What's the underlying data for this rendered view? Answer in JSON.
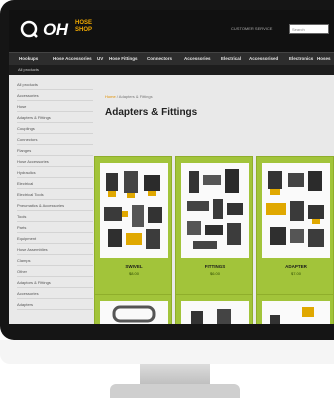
{
  "header": {
    "logo_text": "OH",
    "logo_sub_1": "HOSE",
    "logo_sub_2": "SHOP",
    "links": "CUSTOMER SERVICE",
    "search_placeholder": "Search"
  },
  "nav": {
    "items": [
      "Hookups",
      "Hose Accessories",
      "UV",
      "Hose Fittings",
      "Connectors",
      "Accessories",
      "Electrical",
      "Accessorised",
      "Electronics",
      "Hoses"
    ]
  },
  "subnav": {
    "label": "All products"
  },
  "sidebar": {
    "items": [
      "All products",
      "Accessories",
      "Hose",
      "Adapters & Fittings",
      "Couplings",
      "Connectors",
      "Flanges",
      "Hose Accessories",
      "Hydraulics",
      "Electrical",
      "Electrical Tools",
      "Pneumatics & Accessories",
      "Tools",
      "Parts",
      "Equipment",
      "Hose Assemblies",
      "Clamps",
      "Other",
      "Adaptors & Fittings",
      "Accessories",
      "Adapters"
    ]
  },
  "breadcrumb": {
    "home": "Home",
    "sep": " / ",
    "current": "Adapters & Fittings"
  },
  "main": {
    "title": "Adapters & Fittings"
  },
  "products": [
    {
      "name": "SWIVEL",
      "price": "$8.00"
    },
    {
      "name": "FITTINGS",
      "price": "$6.00"
    },
    {
      "name": "ADAPTER",
      "price": "$7.00"
    }
  ],
  "colors": {
    "header_bg": "#111111",
    "accent_orange": "#f2a900",
    "card_green": "#a2c43a",
    "page_bg": "#e9e9e9"
  }
}
